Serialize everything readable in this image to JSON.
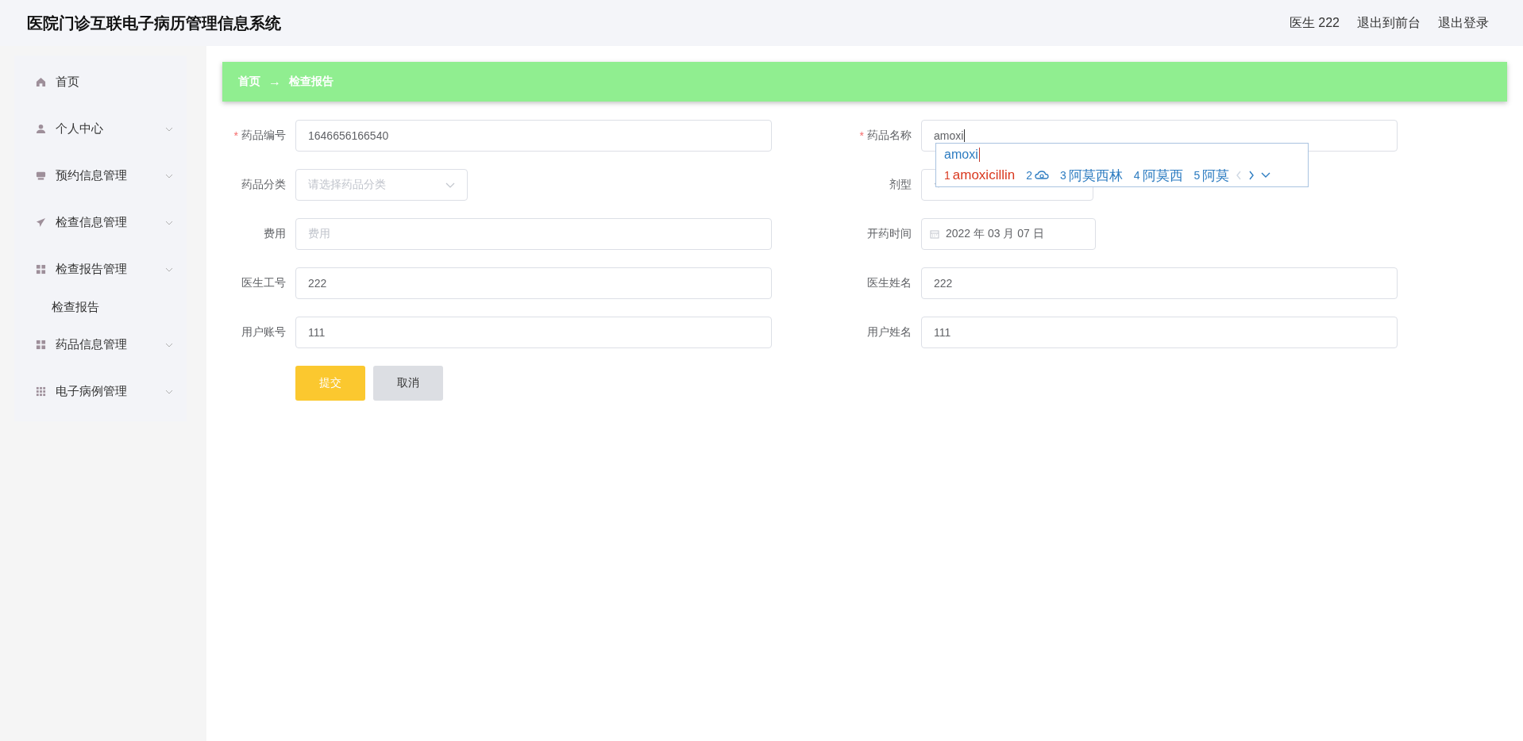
{
  "header": {
    "title": "医院门诊互联电子病历管理信息系统",
    "links": [
      "医生 222",
      "退出到前台",
      "退出登录"
    ]
  },
  "sidebar": {
    "items": [
      {
        "label": "首页",
        "has_submenu": false
      },
      {
        "label": "个人中心",
        "has_submenu": true
      },
      {
        "label": "预约信息管理",
        "has_submenu": true
      },
      {
        "label": "检查信息管理",
        "has_submenu": true
      },
      {
        "label": "检查报告管理",
        "has_submenu": true,
        "children": [
          {
            "label": "检查报告"
          }
        ]
      },
      {
        "label": "药品信息管理",
        "has_submenu": true
      },
      {
        "label": "电子病例管理",
        "has_submenu": true
      }
    ]
  },
  "breadcrumb": {
    "items": [
      "首页",
      "检查报告"
    ],
    "separator": "→"
  },
  "form": {
    "fields": [
      {
        "label": "药品编号",
        "kind": "text",
        "required_mark": "*",
        "value": "1646656166540"
      },
      {
        "label": "药品名称",
        "kind": "text",
        "required_mark": "*",
        "value": "amoxi",
        "ime": true
      },
      {
        "label": "药品分类",
        "kind": "select",
        "placeholder": "请选择药品分类"
      },
      {
        "label": "剂型",
        "kind": "select"
      },
      {
        "label": "费用",
        "kind": "text",
        "placeholder": "费用"
      },
      {
        "label": "开药时间",
        "kind": "date",
        "value": "2022 年 03 月 07 日"
      },
      {
        "label": "医生工号",
        "kind": "text",
        "value": "222"
      },
      {
        "label": "医生姓名",
        "kind": "text",
        "value": "222"
      },
      {
        "label": "用户账号",
        "kind": "text",
        "value": "111"
      },
      {
        "label": "用户姓名",
        "kind": "text",
        "value": "111"
      }
    ],
    "buttons": [
      {
        "label": "提交",
        "kind": "primary"
      },
      {
        "label": "取消",
        "kind": "secondary"
      }
    ]
  },
  "ime_popup": {
    "composition": "amoxi",
    "candidates": [
      {
        "number": "1",
        "text": "amoxicillin",
        "kind": "text",
        "selected": true
      },
      {
        "number": "2",
        "kind": "cloud",
        "selected": false
      },
      {
        "number": "3",
        "text": "阿莫西林",
        "kind": "text",
        "selected": false
      },
      {
        "number": "4",
        "text": "阿莫西",
        "kind": "text",
        "selected": false
      },
      {
        "number": "5",
        "text": "阿莫",
        "kind": "text",
        "selected": false
      }
    ]
  }
}
